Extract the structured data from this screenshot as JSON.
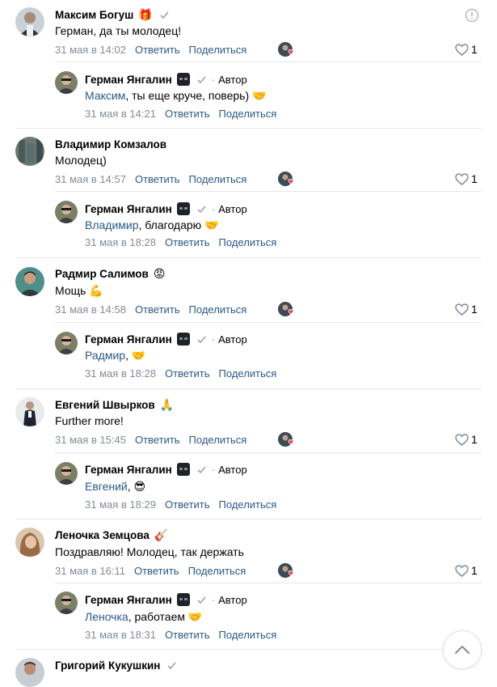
{
  "comments": [
    {
      "name": "Максим Богуш",
      "badge": "🎁",
      "verified": true,
      "text": "Герман, да ты молодец!",
      "date": "31 мая в 14:02",
      "reply_label": "Ответить",
      "share_label": "Поделиться",
      "likes": "1",
      "reply": {
        "name": "Герман Янгалин",
        "author_label": "Автор",
        "mention": "Максим",
        "text": ", ты еще круче, поверь)",
        "emoji": "🤝",
        "date": "31 мая в 14:21",
        "reply_label": "Ответить",
        "share_label": "Поделиться"
      }
    },
    {
      "name": "Владимир Комзалов",
      "badge": "",
      "verified": false,
      "text": "Молодец)",
      "date": "31 мая в 14:57",
      "reply_label": "Ответить",
      "share_label": "Поделиться",
      "likes": "1",
      "reply": {
        "name": "Герман Янгалин",
        "author_label": "Автор",
        "mention": "Владимир",
        "text": ", благодарю",
        "emoji": "🤝",
        "date": "31 мая в 18:28",
        "reply_label": "Ответить",
        "share_label": "Поделиться"
      }
    },
    {
      "name": "Радмир Салимов",
      "badge": "😡",
      "verified": false,
      "text": "Мощь 💪",
      "date": "31 мая в 14:58",
      "reply_label": "Ответить",
      "share_label": "Поделиться",
      "likes": "1",
      "reply": {
        "name": "Герман Янгалин",
        "author_label": "Автор",
        "mention": "Радмир",
        "text": ",",
        "emoji": "🤝",
        "date": "31 мая в 18:28",
        "reply_label": "Ответить",
        "share_label": "Поделиться"
      }
    },
    {
      "name": "Евгений Швырков",
      "badge": "🙏",
      "verified": false,
      "text": "Further more!",
      "date": "31 мая в 15:45",
      "reply_label": "Ответить",
      "share_label": "Поделиться",
      "likes": "1",
      "reply": {
        "name": "Герман Янгалин",
        "author_label": "Автор",
        "mention": "Евгений",
        "text": ",",
        "emoji": "😎",
        "date": "31 мая в 18:29",
        "reply_label": "Ответить",
        "share_label": "Поделиться"
      }
    },
    {
      "name": "Леночка Земцова",
      "badge": "🎸",
      "verified": false,
      "text": "Поздравляю! Молодец, так держать",
      "date": "31 мая в 16:11",
      "reply_label": "Ответить",
      "share_label": "Поделиться",
      "likes": "1",
      "reply": {
        "name": "Герман Янгалин",
        "author_label": "Автор",
        "mention": "Леночка",
        "text": ", работаем",
        "emoji": "🤝",
        "date": "31 мая в 18:31",
        "reply_label": "Ответить",
        "share_label": "Поделиться"
      }
    }
  ],
  "last_comment": {
    "name": "Григорий Кукушкин",
    "verified": true
  },
  "colors": {
    "link": "#2a5885",
    "meta": "#818c99",
    "like_heart": "#e64646",
    "separator": "#e7e8ec"
  },
  "icons": {
    "info": "info-icon",
    "scroll_up": "chevron-up-icon",
    "like": "heart-icon",
    "verified": "check-icon"
  }
}
